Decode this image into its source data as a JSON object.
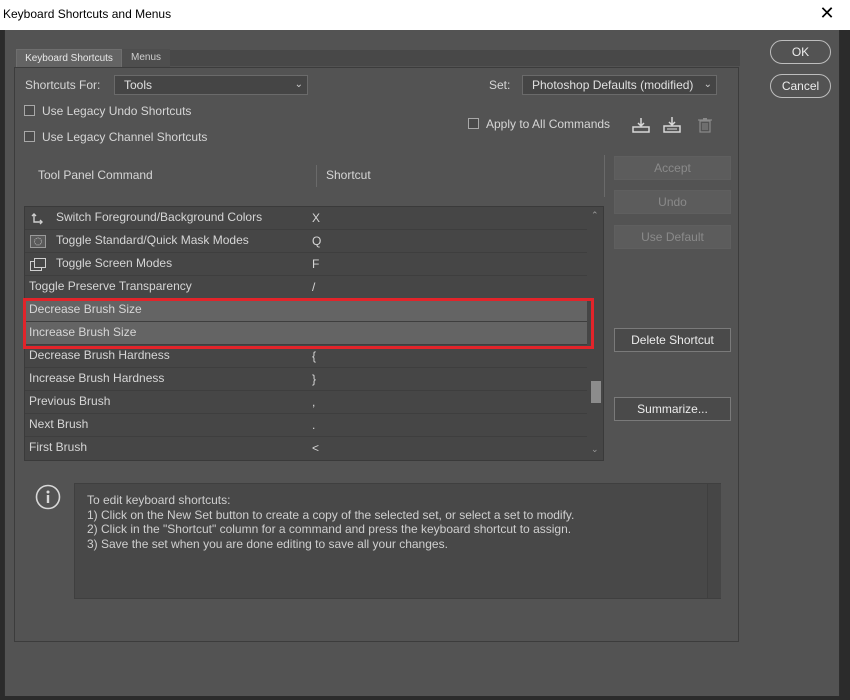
{
  "window": {
    "title": "Keyboard Shortcuts and Menus",
    "close_glyph": "✕"
  },
  "tabs": [
    {
      "label": "Keyboard Shortcuts",
      "active": true
    },
    {
      "label": "Menus",
      "active": false
    }
  ],
  "shortcuts_for": {
    "label": "Shortcuts For:",
    "value": "Tools"
  },
  "set": {
    "label": "Set:",
    "value": "Photoshop Defaults (modified)"
  },
  "checkboxes": {
    "legacy_undo": {
      "label": "Use Legacy Undo Shortcuts",
      "checked": false
    },
    "legacy_channel": {
      "label": "Use Legacy Channel Shortcuts",
      "checked": false
    },
    "apply_all": {
      "label": "Apply to All Commands",
      "checked": false
    }
  },
  "set_icons": [
    "save-set-icon",
    "save-as-set-icon",
    "delete-set-icon"
  ],
  "table": {
    "columns": [
      "Tool Panel Command",
      "Shortcut"
    ],
    "rows": [
      {
        "command": "Switch Foreground/Background Colors",
        "shortcut": "X",
        "icon": "switch-colors-icon",
        "selected": false
      },
      {
        "command": "Toggle Standard/Quick Mask Modes",
        "shortcut": "Q",
        "icon": "quick-mask-icon",
        "selected": false
      },
      {
        "command": "Toggle Screen Modes",
        "shortcut": "F",
        "icon": "screen-modes-icon",
        "selected": false
      },
      {
        "command": "Toggle Preserve Transparency",
        "shortcut": "/",
        "icon": null,
        "selected": false
      },
      {
        "command": "Decrease Brush Size",
        "shortcut": "",
        "icon": null,
        "selected": true
      },
      {
        "command": "Increase Brush Size",
        "shortcut": "",
        "icon": null,
        "selected": true
      },
      {
        "command": "Decrease Brush Hardness",
        "shortcut": "{",
        "icon": null,
        "selected": false
      },
      {
        "command": "Increase Brush Hardness",
        "shortcut": "}",
        "icon": null,
        "selected": false
      },
      {
        "command": "Previous Brush",
        "shortcut": ",",
        "icon": null,
        "selected": false
      },
      {
        "command": "Next Brush",
        "shortcut": ".",
        "icon": null,
        "selected": false
      },
      {
        "command": "First Brush",
        "shortcut": "<",
        "icon": null,
        "selected": false
      }
    ]
  },
  "side_buttons": {
    "accept": "Accept",
    "undo": "Undo",
    "use_default": "Use Default",
    "delete_shortcut": "Delete Shortcut",
    "summarize": "Summarize..."
  },
  "dialog_buttons": {
    "ok": "OK",
    "cancel": "Cancel"
  },
  "info": {
    "icon": "info-icon",
    "lines": [
      "To edit keyboard shortcuts:",
      "1) Click on the New Set button to create a copy of the selected set, or select a set to modify.",
      "2) Click in the \"Shortcut\" column for a command and press the keyboard shortcut to assign.",
      "3) Save the set when you are done editing to save all your changes."
    ]
  },
  "colors": {
    "highlight": "#e2242a",
    "panel": "#535353",
    "selected_row": "#646464"
  }
}
